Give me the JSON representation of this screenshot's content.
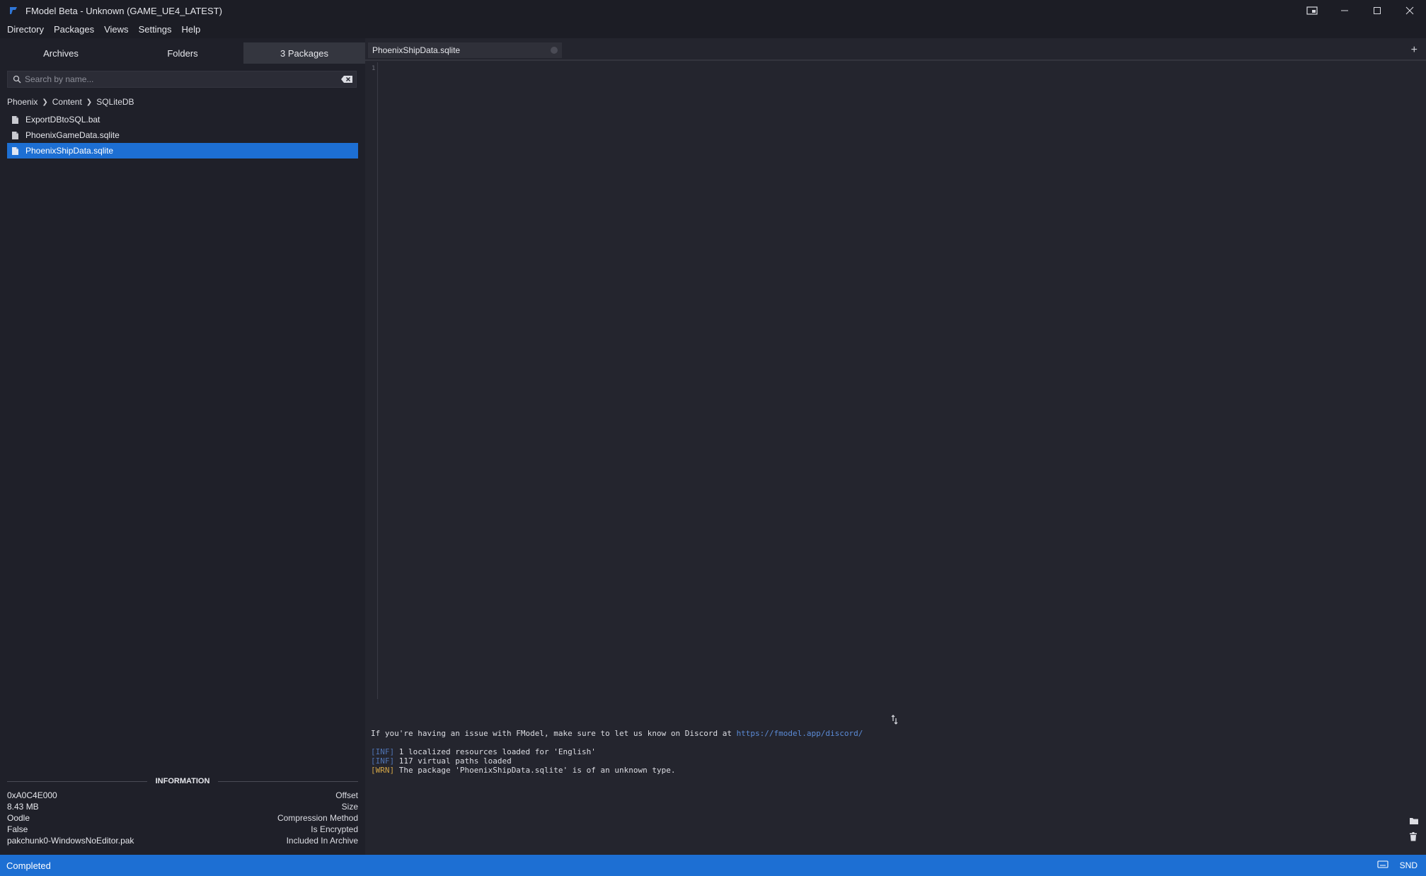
{
  "window": {
    "title": "FModel Beta - Unknown (GAME_UE4_LATEST)"
  },
  "menu": [
    "Directory",
    "Packages",
    "Views",
    "Settings",
    "Help"
  ],
  "sidebar": {
    "tabs": [
      {
        "label": "Archives",
        "active": false
      },
      {
        "label": "Folders",
        "active": false
      },
      {
        "label": "3 Packages",
        "active": true
      }
    ],
    "search": {
      "placeholder": "Search by name...",
      "value": ""
    },
    "breadcrumb": [
      "Phoenix",
      "Content",
      "SQLiteDB"
    ],
    "files": [
      {
        "name": "ExportDBtoSQL.bat",
        "selected": false
      },
      {
        "name": "PhoenixGameData.sqlite",
        "selected": false
      },
      {
        "name": "PhoenixShipData.sqlite",
        "selected": true
      }
    ],
    "information": {
      "title": "INFORMATION",
      "rows": [
        {
          "value": "0xA0C4E000",
          "label": "Offset"
        },
        {
          "value": "8.43 MB",
          "label": "Size"
        },
        {
          "value": "Oodle",
          "label": "Compression Method"
        },
        {
          "value": "False",
          "label": "Is Encrypted"
        },
        {
          "value": "pakchunk0-WindowsNoEditor.pak",
          "label": "Included In Archive"
        }
      ]
    }
  },
  "editor": {
    "tab_title": "PhoenixShipData.sqlite",
    "add_tab": "+",
    "line_number": "1"
  },
  "console": {
    "discord_prefix": "If you're having an issue with FModel, make sure to let us know on Discord at ",
    "discord_link": "https://fmodel.app/discord/",
    "logs": [
      {
        "tag": "[INF]",
        "text": " 1 localized resources loaded for 'English'"
      },
      {
        "tag": "[INF]",
        "text": " 117 virtual paths loaded"
      },
      {
        "tag": "[WRN]",
        "text": " The package 'PhoenixShipData.sqlite' is of an unknown type."
      }
    ]
  },
  "statusbar": {
    "status": "Completed",
    "right_label": "SND"
  },
  "colors": {
    "accent": "#1d6fd3",
    "background": "#24252e",
    "panel": "#1f2029",
    "inf": "#4f74b4",
    "wrn": "#d2a546",
    "link": "#5b8bd6"
  },
  "icons": [
    "app-logo-icon",
    "snap-layout-icon",
    "minimize-icon",
    "maximize-icon",
    "close-icon",
    "search-icon",
    "clear-search-icon",
    "file-icon",
    "chevron-right-icon",
    "add-tab-icon",
    "splitter-icon",
    "folder-icon",
    "trash-icon",
    "keyboard-icon"
  ]
}
